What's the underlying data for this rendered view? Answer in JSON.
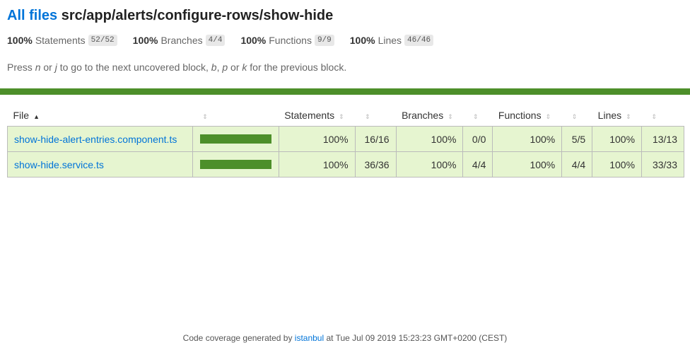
{
  "header": {
    "all_files_link": "All files",
    "path": "src/app/alerts/configure-rows/show-hide"
  },
  "summary": [
    {
      "pct": "100%",
      "label": "Statements",
      "fraction": "52/52"
    },
    {
      "pct": "100%",
      "label": "Branches",
      "fraction": "4/4"
    },
    {
      "pct": "100%",
      "label": "Functions",
      "fraction": "9/9"
    },
    {
      "pct": "100%",
      "label": "Lines",
      "fraction": "46/46"
    }
  ],
  "hint": {
    "t1": "Press ",
    "k1": "n",
    "t2": " or ",
    "k2": "j",
    "t3": " to go to the next uncovered block, ",
    "k3": "b",
    "t4": ", ",
    "k4": "p",
    "t5": " or ",
    "k5": "k",
    "t6": " for the previous block."
  },
  "table": {
    "headers": {
      "file": "File",
      "statements": "Statements",
      "branches": "Branches",
      "functions": "Functions",
      "lines": "Lines"
    },
    "rows": [
      {
        "file": "show-hide-alert-entries.component.ts",
        "coverage_fraction": 1.0,
        "statements_pct": "100%",
        "statements": "16/16",
        "branches_pct": "100%",
        "branches": "0/0",
        "functions_pct": "100%",
        "functions": "5/5",
        "lines_pct": "100%",
        "lines": "13/13"
      },
      {
        "file": "show-hide.service.ts",
        "coverage_fraction": 1.0,
        "statements_pct": "100%",
        "statements": "36/36",
        "branches_pct": "100%",
        "branches": "4/4",
        "functions_pct": "100%",
        "functions": "4/4",
        "lines_pct": "100%",
        "lines": "33/33"
      }
    ]
  },
  "footer": {
    "prefix": "Code coverage generated by ",
    "tool": "istanbul",
    "suffix": " at Tue Jul 09 2019 15:23:23 GMT+0200 (CEST)"
  },
  "colors": {
    "high_coverage": "#4d8f2a",
    "row_background": "#e6f5d0",
    "link": "#0074d9"
  },
  "icons": {
    "sort_asc": "sort-ascending-icon",
    "sortable": "sortable-icon"
  }
}
